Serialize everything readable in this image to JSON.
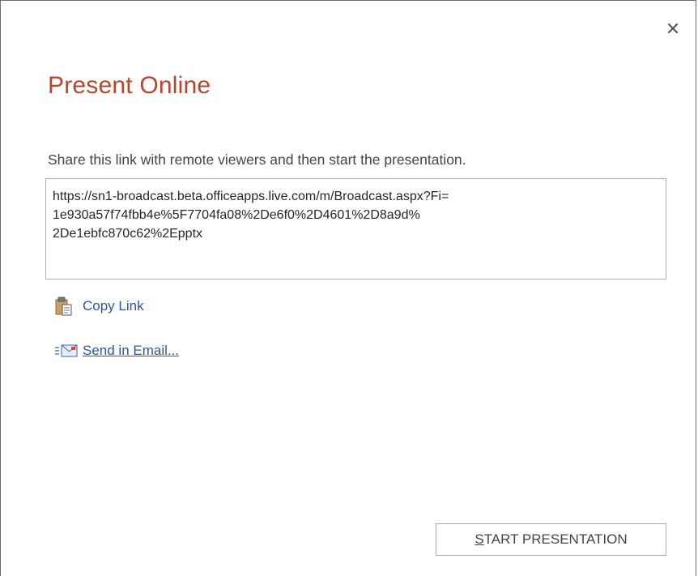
{
  "dialog": {
    "title": "Present Online",
    "close_glyph": "×",
    "instructions": "Share this link with remote viewers and then start the presentation.",
    "link_url": "https://sn1-broadcast.beta.officeapps.live.com/m/Broadcast.aspx?Fi=\n1e930a57f74fbb4e%5F7704fa08%2De6f0%2D4601%2D8a9d%\n2De1ebfc870c62%2Epptx"
  },
  "actions": {
    "copy_link": {
      "label": "Copy Link",
      "icon": "clipboard-icon"
    },
    "send_email": {
      "label": "Send in Email...",
      "icon": "email-icon"
    }
  },
  "start_button": {
    "mnemonic": "S",
    "label_rest": "TART PRESENTATION"
  },
  "colors": {
    "title": "#b7472a",
    "link": "#2b579a",
    "text": "#444444",
    "border": "#ababab"
  }
}
